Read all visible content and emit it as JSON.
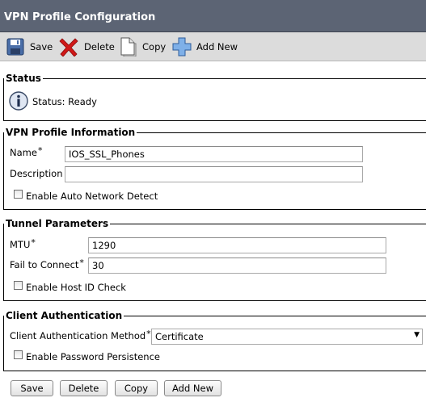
{
  "header": {
    "title": "VPN Profile Configuration"
  },
  "toolbar": {
    "save_label": "Save",
    "delete_label": "Delete",
    "copy_label": "Copy",
    "add_new_label": "Add New"
  },
  "status": {
    "legend": "Status",
    "text": "Status: Ready",
    "icon": "info-icon"
  },
  "vpn_profile": {
    "legend": "VPN Profile Information",
    "name_label": "Name",
    "name_value": "IOS_SSL_Phones",
    "description_label": "Description",
    "description_value": "",
    "auto_network_detect_label": "Enable Auto Network Detect",
    "auto_network_detect_checked": false
  },
  "tunnel": {
    "legend": "Tunnel Parameters",
    "mtu_label": "MTU",
    "mtu_value": "1290",
    "fail_to_connect_label": "Fail to Connect",
    "fail_to_connect_value": "30",
    "host_id_check_label": "Enable Host ID Check",
    "host_id_check_checked": false
  },
  "client_auth": {
    "legend": "Client Authentication",
    "method_label": "Client Authentication Method",
    "method_value": "Certificate",
    "password_persistence_label": "Enable Password Persistence",
    "password_persistence_checked": false
  },
  "required_marker": "*",
  "footer": {
    "save_label": "Save",
    "delete_label": "Delete",
    "copy_label": "Copy",
    "add_new_label": "Add New"
  },
  "colors": {
    "title_bar": "#5c6474",
    "toolbar": "#dcdcdc",
    "delete_icon": "#d01818",
    "add_icon": "#4a8ad0"
  }
}
